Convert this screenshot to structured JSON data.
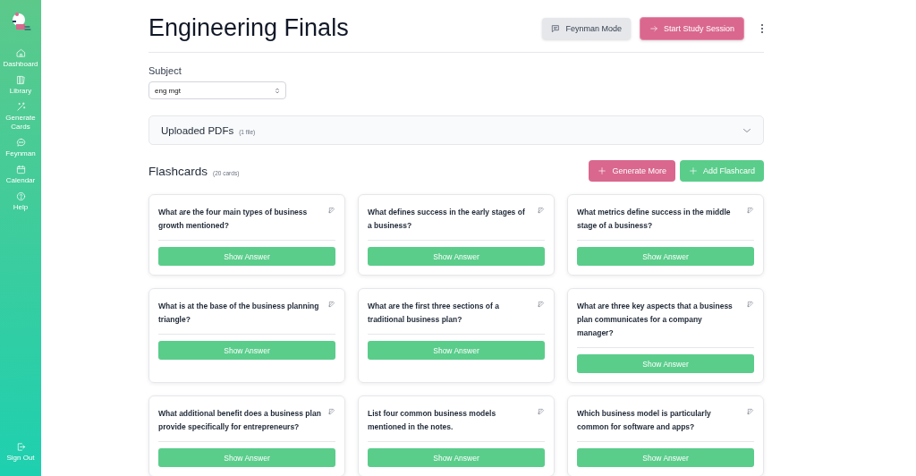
{
  "sidebar": {
    "items": [
      {
        "label": "Dashboard",
        "selected": false
      },
      {
        "label": "Library",
        "selected": false
      },
      {
        "label": "Generate Cards",
        "selected": false
      },
      {
        "label": "Feynman",
        "selected": false
      },
      {
        "label": "Calendar",
        "selected": false
      },
      {
        "label": "Help",
        "selected": false
      }
    ],
    "sign_out": "Sign Out"
  },
  "header": {
    "title": "Engineering Finals",
    "buttons": [
      {
        "label": "Feynman Mode",
        "kind": "secondary"
      },
      {
        "label": "Start Study Session",
        "kind": "primary"
      }
    ]
  },
  "subject": {
    "label": "Subject",
    "value": "eng mgt"
  },
  "uploaded": {
    "title": "Uploaded PDFs",
    "count": "(1 file)",
    "expanded": false
  },
  "flashcards": {
    "title": "Flashcards",
    "count": "(20 cards)",
    "buttons": [
      {
        "label": "Generate More",
        "kind": "pink"
      },
      {
        "label": "Add Flashcard",
        "kind": "green"
      }
    ],
    "cards": [
      {
        "question": "What are the four main types of business growth mentioned?",
        "button": "Show Answer"
      },
      {
        "question": "What defines success in the early stages of a business?",
        "button": "Show Answer"
      },
      {
        "question": "What metrics define success in the middle stage of a business?",
        "button": "Show Answer"
      },
      {
        "question": "What is at the base of the business planning triangle?",
        "button": "Show Answer"
      },
      {
        "question": "What are the first three sections of a traditional business plan?",
        "button": "Show Answer"
      },
      {
        "question": "What are three key aspects that a business plan communicates for a company manager?",
        "button": "Show Answer"
      },
      {
        "question": "What additional benefit does a business plan provide specifically for entrepreneurs?",
        "button": "Show Answer"
      },
      {
        "question": "List four common business models mentioned in the notes.",
        "button": "Show Answer"
      },
      {
        "question": "Which business model is particularly common for software and apps?",
        "button": "Show Answer"
      }
    ]
  }
}
